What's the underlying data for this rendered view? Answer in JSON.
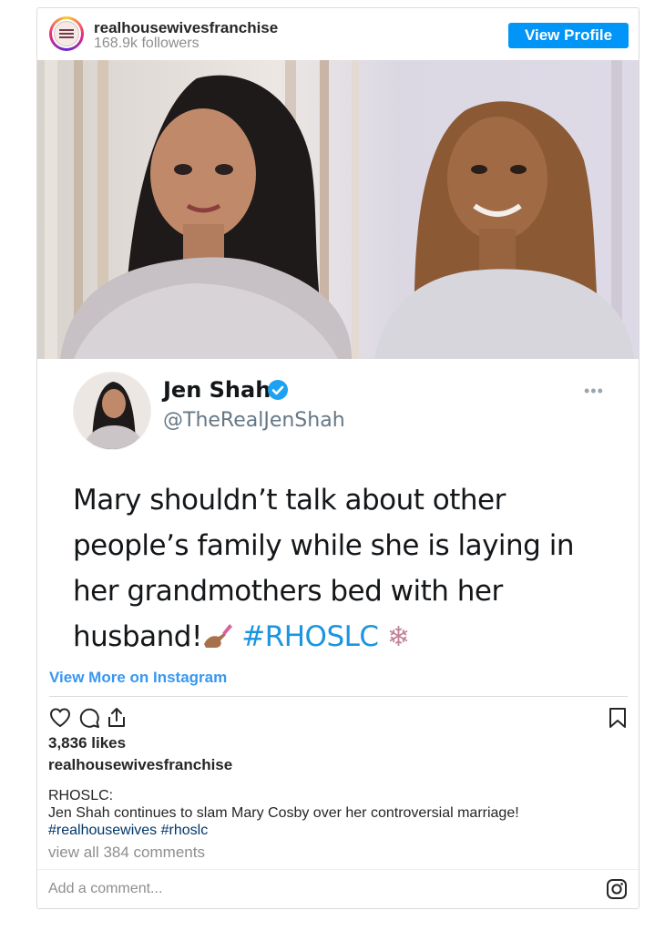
{
  "header": {
    "username": "realhousewivesfranchise",
    "followers": "168.9k followers",
    "view_profile_label": "View Profile"
  },
  "tweet": {
    "name": "Jen Shah",
    "handle": "@TheRealJenShah",
    "more": "•••",
    "text_line1": "Mary shouldn’t talk about other",
    "text_line2": "people’s family while she is laying in",
    "text_line3": "her grandmothers bed with her",
    "text_line4": "husband!",
    "hashtag": "#RHOSLC",
    "snowflake": "❄"
  },
  "post": {
    "view_more_label": "View More on Instagram",
    "likes": "3,836 likes",
    "owner": "realhousewivesfranchise",
    "caption_line1": "RHOSLC:",
    "caption_line2": "Jen Shah continues to slam Mary Cosby over her controversial marriage!",
    "caption_tags": "#realhousewives #rhoslc",
    "comments_link": "view all 384 comments",
    "add_comment_placeholder": "Add a comment..."
  },
  "colors": {
    "accent": "#0095f6",
    "link": "#3897f0",
    "twitter_blue": "#1b95e0",
    "hashtag_dark": "#003569"
  },
  "icons": [
    "heart-icon",
    "comment-icon",
    "share-icon",
    "bookmark-icon",
    "instagram-icon",
    "verified-badge-icon",
    "snowflake-icon",
    "nail-polish-icon"
  ]
}
